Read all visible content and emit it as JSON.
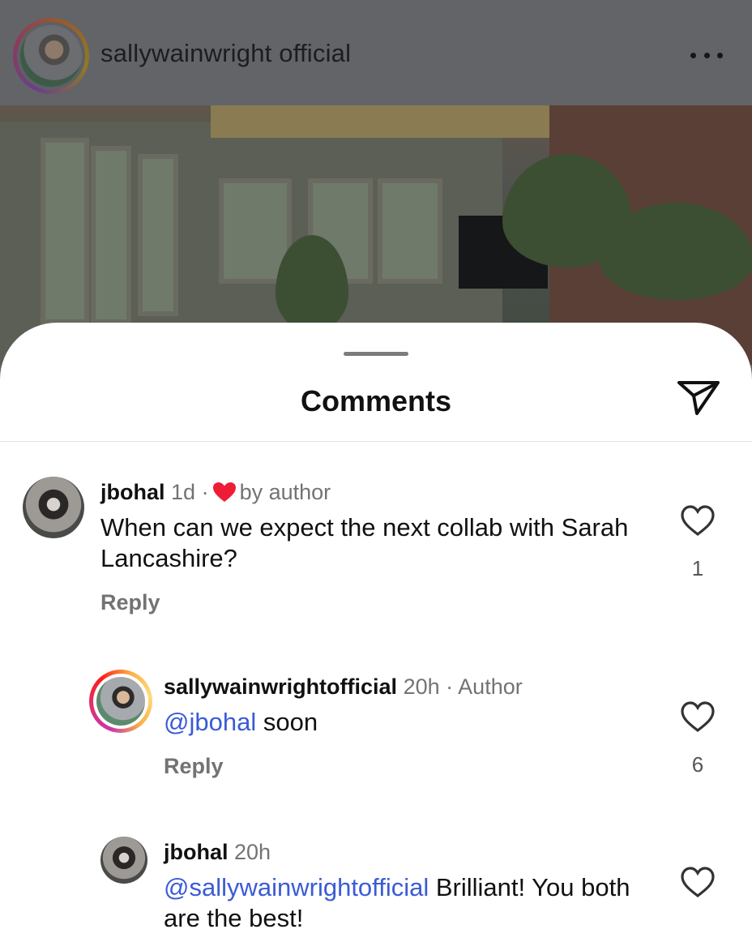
{
  "post": {
    "username": "sallywainwright official"
  },
  "sheet": {
    "title": "Comments"
  },
  "comments": [
    {
      "username": "jbohal",
      "time": "1d",
      "separator": "·",
      "badge": "by author",
      "text": "When can we expect the next collab with Sarah Lancashire?",
      "reply_label": "Reply",
      "likes": "1"
    },
    {
      "username": "sallywainwrightofficial",
      "time": "20h",
      "separator": "·",
      "badge": "Author",
      "mention": "@jbohal",
      "text": " soon",
      "reply_label": "Reply",
      "likes": "6"
    },
    {
      "username": "jbohal",
      "time": "20h",
      "mention": "@sallywainwrightofficial",
      "text": " Brilliant! You both are the best!"
    }
  ],
  "colors": {
    "liked_heart": "#ee1d36",
    "mention": "#3a5bd6",
    "muted": "#737373"
  }
}
